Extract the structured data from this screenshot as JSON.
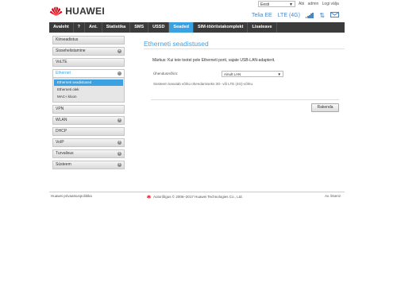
{
  "header": {
    "brand": "HUAWEI",
    "language": "Eesti",
    "user_name": "Abi",
    "user_role": "admin",
    "logout": "Logi välja",
    "operator": "Telia EE",
    "network_type": "LTE (4G)",
    "signal_bars": 5,
    "colors": {
      "accent": "#3ca1e0",
      "nav_bg": "#3b3b3b"
    }
  },
  "nav": {
    "items": [
      {
        "label": "Avaleht"
      },
      {
        "label": "?"
      },
      {
        "label": "Ant."
      },
      {
        "label": "Statistika"
      },
      {
        "label": "SMS"
      },
      {
        "label": "USSD"
      },
      {
        "label": "Seaded",
        "active": true
      },
      {
        "label": "SIM-tööriistakomplekt"
      },
      {
        "label": "Lisateave"
      }
    ]
  },
  "sidebar": {
    "items": [
      {
        "label": "Kiirseadistus",
        "expandable": false
      },
      {
        "label": "Sissehelistamine",
        "expandable": true
      },
      {
        "label": "VoLTE",
        "expandable": false
      },
      {
        "label": "Ethernet",
        "expandable": true,
        "open": true
      },
      {
        "label": "VPN",
        "expandable": false
      },
      {
        "label": "WLAN",
        "expandable": true
      },
      {
        "label": "DHCP",
        "expandable": false
      },
      {
        "label": "VoIP",
        "expandable": true
      },
      {
        "label": "Turvalisus",
        "expandable": true
      },
      {
        "label": "Süsteem",
        "expandable": true
      }
    ],
    "ethernet_sub": [
      {
        "label": "Etherneti seadistused",
        "active": true
      },
      {
        "label": "Etherneti olek",
        "active": false
      },
      {
        "label": "MAC-i kloon",
        "active": false
      }
    ]
  },
  "content": {
    "title": "Etherneti seadistused",
    "notice": "Märkus: Kui teie tootel pole Etherneti porti, vajate USB-LAN-adapterit.",
    "mode_label": "Ühendusrežiim:",
    "mode_value": "Ainult LAN",
    "mode_help": "Süsteem kasutab võrku ühendamiseks 3G- või LTE (4G)-võrku.",
    "apply_label": "Rakenda"
  },
  "footer": {
    "privacy": "Huawei privaatsuspoliitika",
    "copyright": "Autoriõigus © 2006–2017 Huawei Technologies Co., Ltd.",
    "open_source": "Av. litsenz"
  }
}
